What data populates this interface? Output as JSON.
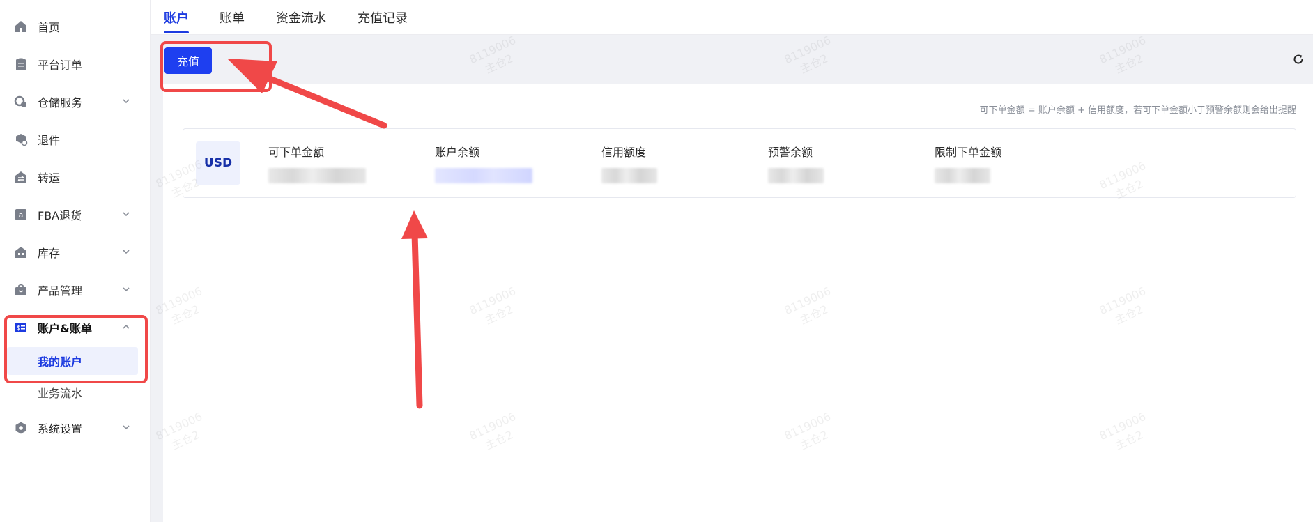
{
  "sidebar": {
    "items": [
      {
        "label": "首页",
        "icon": "home-icon"
      },
      {
        "label": "平台订单",
        "icon": "clipboard-icon"
      },
      {
        "label": "仓储服务",
        "icon": "warehouse-service-icon"
      },
      {
        "label": "退件",
        "icon": "return-parcel-icon"
      },
      {
        "label": "转运",
        "icon": "transfer-icon"
      },
      {
        "label": "FBA退货",
        "icon": "amazon-icon"
      },
      {
        "label": "库存",
        "icon": "inventory-icon"
      },
      {
        "label": "产品管理",
        "icon": "product-bag-icon"
      },
      {
        "label": "账户&账单",
        "icon": "account-bill-icon"
      },
      {
        "label": "系统设置",
        "icon": "settings-hexagon-icon"
      }
    ],
    "sub_items": {
      "active": "我的账户",
      "other": "业务流水"
    }
  },
  "tabs": [
    "账户",
    "账单",
    "资金流水",
    "充值记录"
  ],
  "toolbar": {
    "recharge_label": "充值"
  },
  "hint": "可下单金额 = 账户余额 + 信用额度，若可下单金额小于预警余额则会给出提醒",
  "account": {
    "currency": "USD",
    "metrics": [
      "可下单金额",
      "账户余额",
      "信用额度",
      "预警余额",
      "限制下单金额"
    ]
  },
  "watermark": {
    "line1": "8119006",
    "line2": "主仓2"
  },
  "colors": {
    "brand": "#1e3ff0",
    "annotation": "#f04848"
  }
}
